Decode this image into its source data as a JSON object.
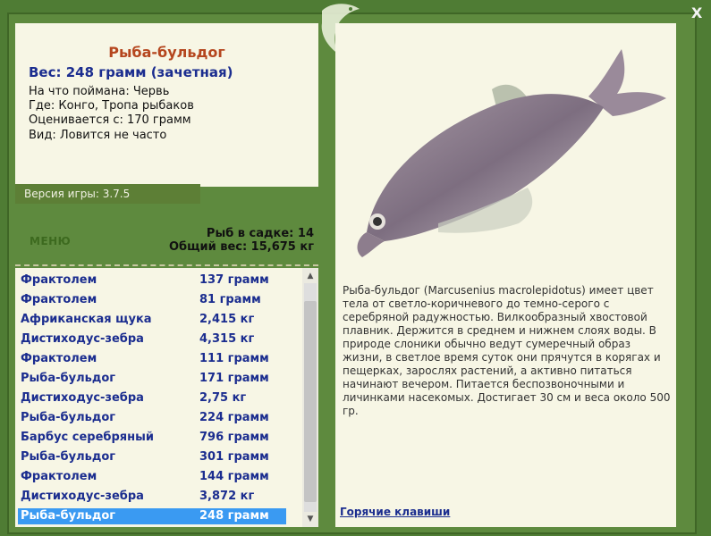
{
  "fish": {
    "title": "Рыба-бульдог",
    "weight": "Вес: 248 грамм (зачетная)",
    "bait": "На что поймана: Червь",
    "location": "Где: Конго, Тропа рыбаков",
    "valued": "Оценивается с: 170 грамм",
    "rarity": "Вид: Ловится не часто"
  },
  "version": "Версия игры: 3.7.5",
  "menu_label": "МЕНЮ",
  "stats": {
    "count": "Рыб в садке: 14",
    "total": "Общий вес: 15,675 кг"
  },
  "catch_list": [
    {
      "name": "Фрактолем",
      "weight": "137 грамм"
    },
    {
      "name": "Фрактолем",
      "weight": "81 грамм"
    },
    {
      "name": "Африканская щука",
      "weight": "2,415 кг"
    },
    {
      "name": "Дистиходус-зебра",
      "weight": "4,315 кг"
    },
    {
      "name": "Фрактолем",
      "weight": "111 грамм"
    },
    {
      "name": "Рыба-бульдог",
      "weight": "171 грамм"
    },
    {
      "name": "Дистиходус-зебра",
      "weight": "2,75 кг"
    },
    {
      "name": "Рыба-бульдог",
      "weight": "224 грамм"
    },
    {
      "name": "Барбус серебряный",
      "weight": "796 грамм"
    },
    {
      "name": "Рыба-бульдог",
      "weight": "301 грамм"
    },
    {
      "name": "Фрактолем",
      "weight": "144 грамм"
    },
    {
      "name": "Дистиходус-зебра",
      "weight": "3,872 кг"
    },
    {
      "name": "Рыба-бульдог",
      "weight": "248 грамм",
      "selected": true
    }
  ],
  "description": "Рыба-бульдог (Marcusenius macrolepidotus) имеет цвет тела от светло-коричневого до темно-серого с серебряной радужностью. Вилкообразный хвостовой плавник. Держится в среднем и нижнем слоях воды. В природе слоники обычно ведут сумеречный образ жизни, в светлое время суток они прячутся в корягах и пещерках, зарослях растений, а активно питаться начинают вечером. Питается беспозвоночными и личинками насекомых. Достигает 30 см и веса около 500 гр.",
  "hotkeys_label": "Горячие клавиши",
  "close_label": "X",
  "colors": {
    "background": "#4f7c34",
    "panel": "#f7f6e5",
    "title": "#b5461e",
    "text_blue": "#1b2d8f",
    "selected": "#3a9af2",
    "version_bar": "#5d7f36"
  }
}
